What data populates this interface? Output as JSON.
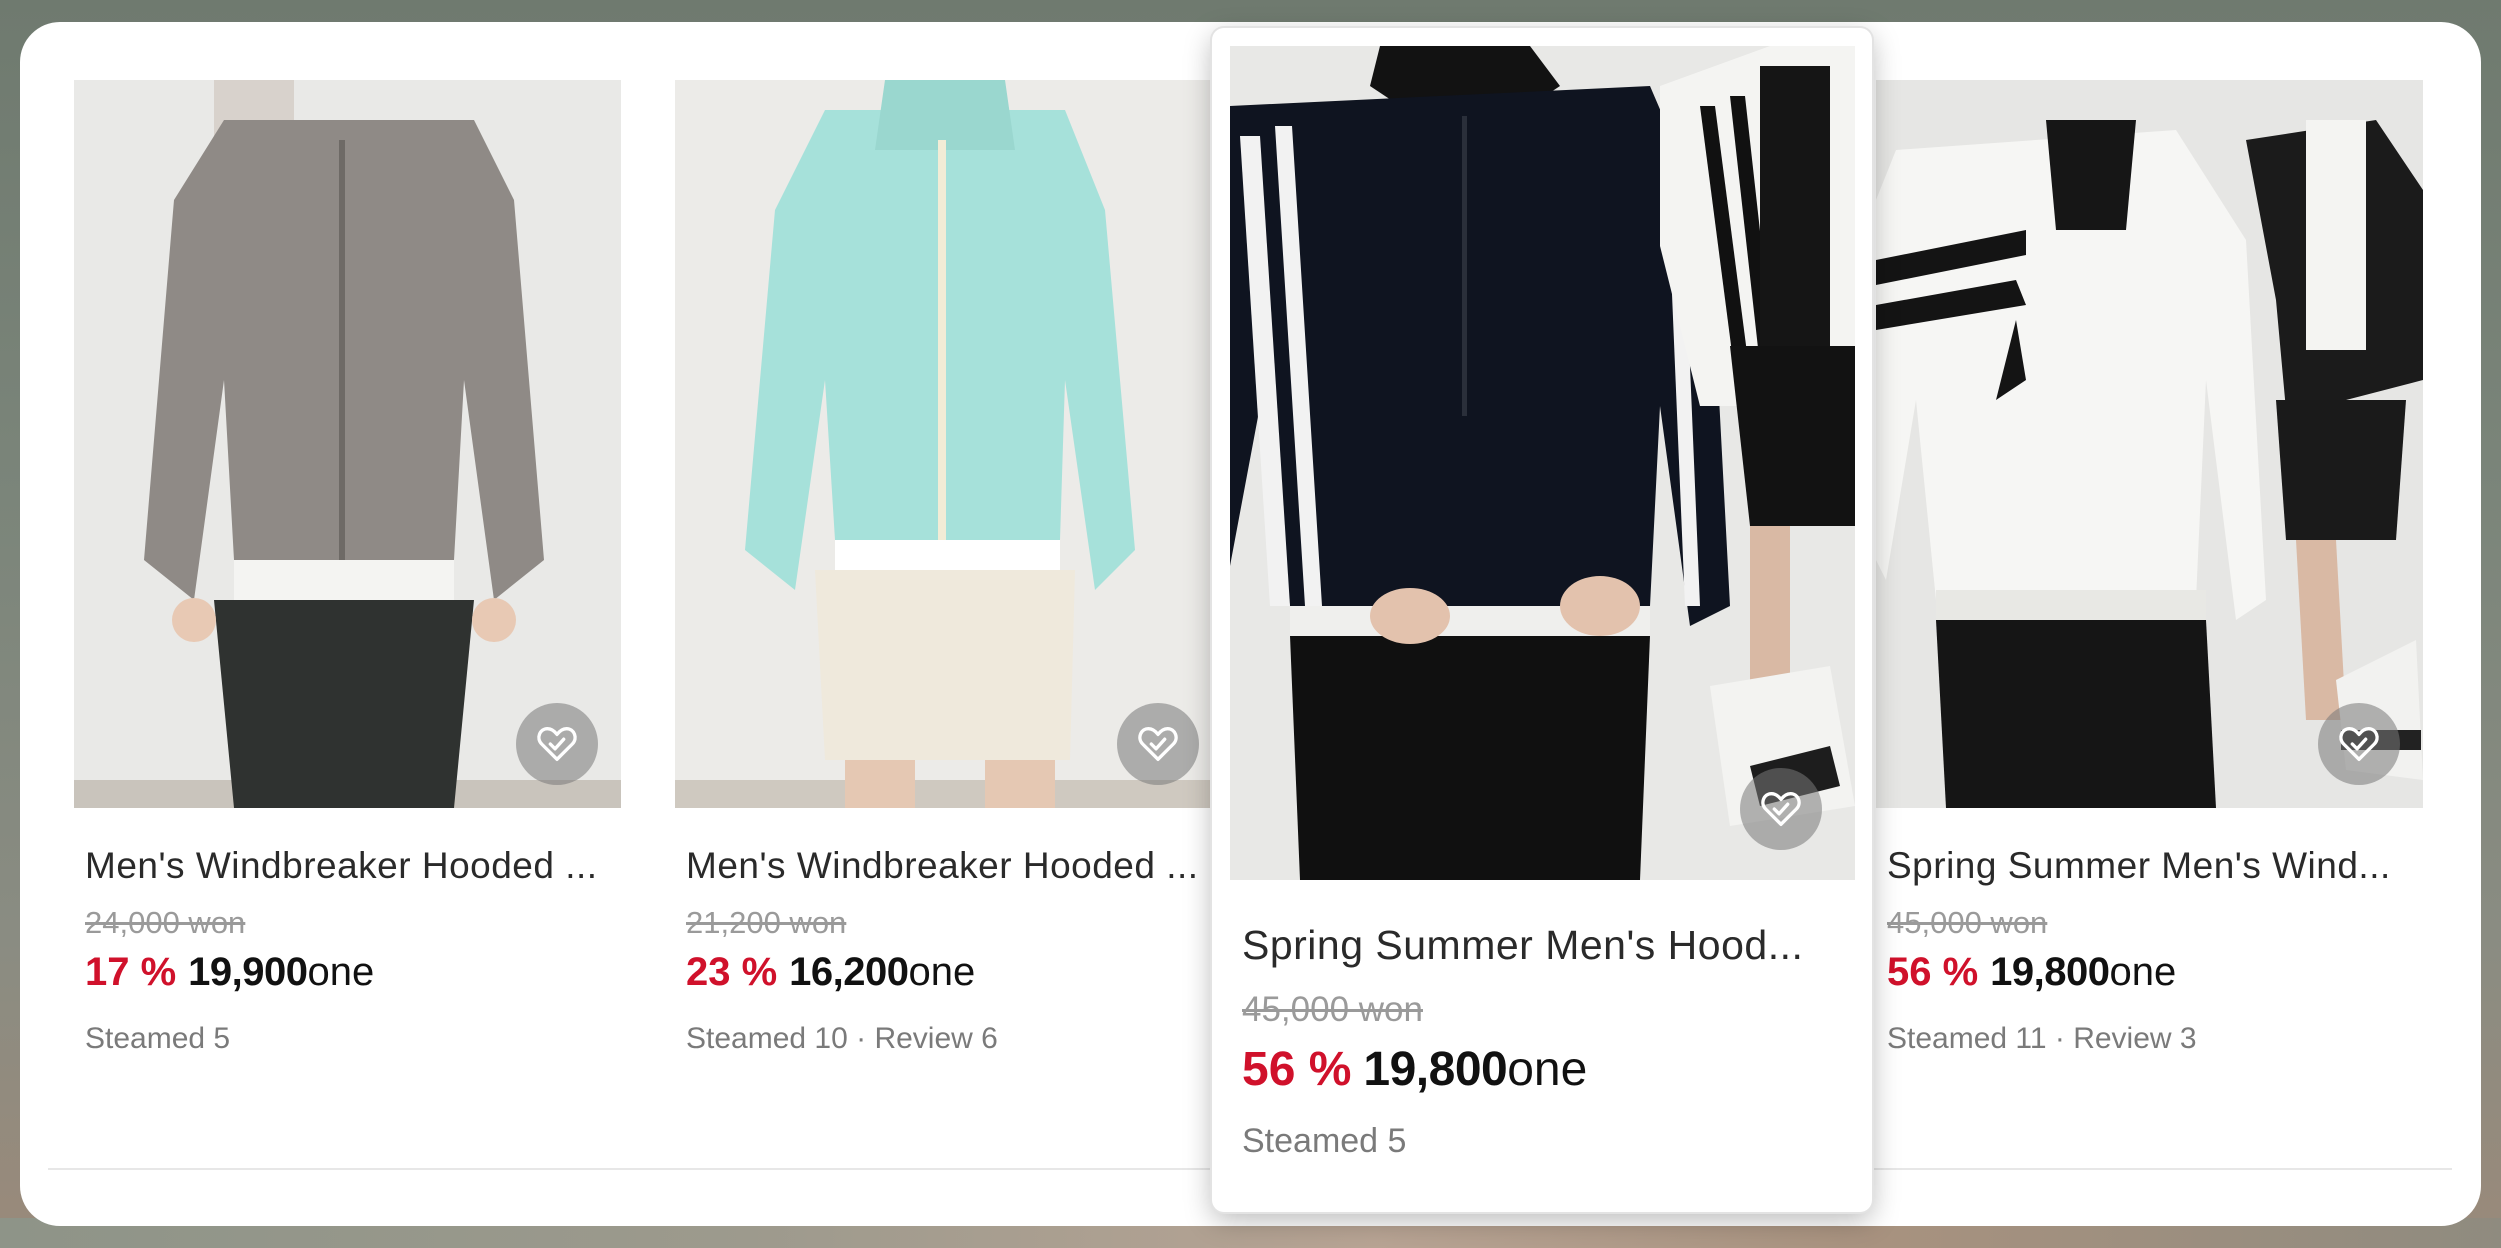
{
  "wishlist_icon": "heart-check-icon",
  "colors": {
    "discount": "#d0112b",
    "price": "#111111",
    "muted": "#7a7a7a"
  },
  "products": [
    {
      "title": "Men's Windbreaker Hooded ...",
      "original_price": "24,000 won",
      "discount": "17 %",
      "price": "19,900",
      "unit": "one",
      "meta": "Steamed 5"
    },
    {
      "title": "Men's Windbreaker Hooded ...",
      "original_price": "21,200 won",
      "discount": "23 %",
      "price": "16,200",
      "unit": "one",
      "meta": "Steamed 10 · Review 6"
    },
    {
      "title": "Spring Summer Men's Hood...",
      "original_price": "45,000 won",
      "discount": "56 %",
      "price": "19,800",
      "unit": "one",
      "meta": "Steamed 5"
    },
    {
      "title": "Spring Summer Men's Wind...",
      "original_price": "45,000 won",
      "discount": "56 %",
      "price": "19,800",
      "unit": "one",
      "meta": "Steamed 11 · Review 3"
    }
  ]
}
